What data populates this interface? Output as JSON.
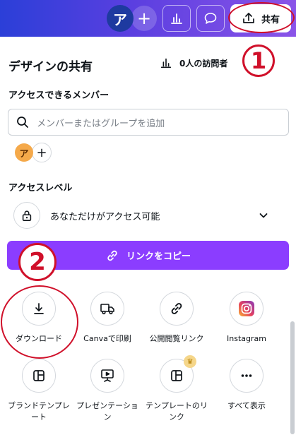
{
  "topbar": {
    "avatar_initial": "ア",
    "plus": "+",
    "share_label": "共有",
    "share_icon": "upload-icon",
    "analytics_icon": "bar-chart-icon",
    "comment_icon": "comment-icon"
  },
  "panel": {
    "title": "デザインの共有",
    "visitors": "0人の訪問者",
    "members_label": "アクセスできるメンバー",
    "search_placeholder": "メンバーまたはグループを追加",
    "member_initial": "ア",
    "member_add": "+",
    "access_level_label": "アクセスレベル",
    "access_value": "あなただけがアクセス可能",
    "copy_link_label": "リンクをコピー"
  },
  "annotations": {
    "marker1": "1",
    "marker2": "2"
  },
  "options": [
    {
      "label": "ダウンロード",
      "icon": "download-icon"
    },
    {
      "label": "Canvaで印刷",
      "icon": "truck-icon"
    },
    {
      "label": "公開閲覧リンク",
      "icon": "link-icon"
    },
    {
      "label": "Instagram",
      "icon": "instagram-icon"
    },
    {
      "label": "ブランドテンプレート",
      "icon": "template-icon"
    },
    {
      "label": "プレゼンテーション",
      "icon": "presentation-icon"
    },
    {
      "label": "テンプレートのリンク",
      "icon": "template-link-icon"
    },
    {
      "label": "すべて表示",
      "icon": "more-icon"
    }
  ],
  "colors": {
    "accent": "#8b3dff",
    "annotation_red": "#d0102a"
  }
}
